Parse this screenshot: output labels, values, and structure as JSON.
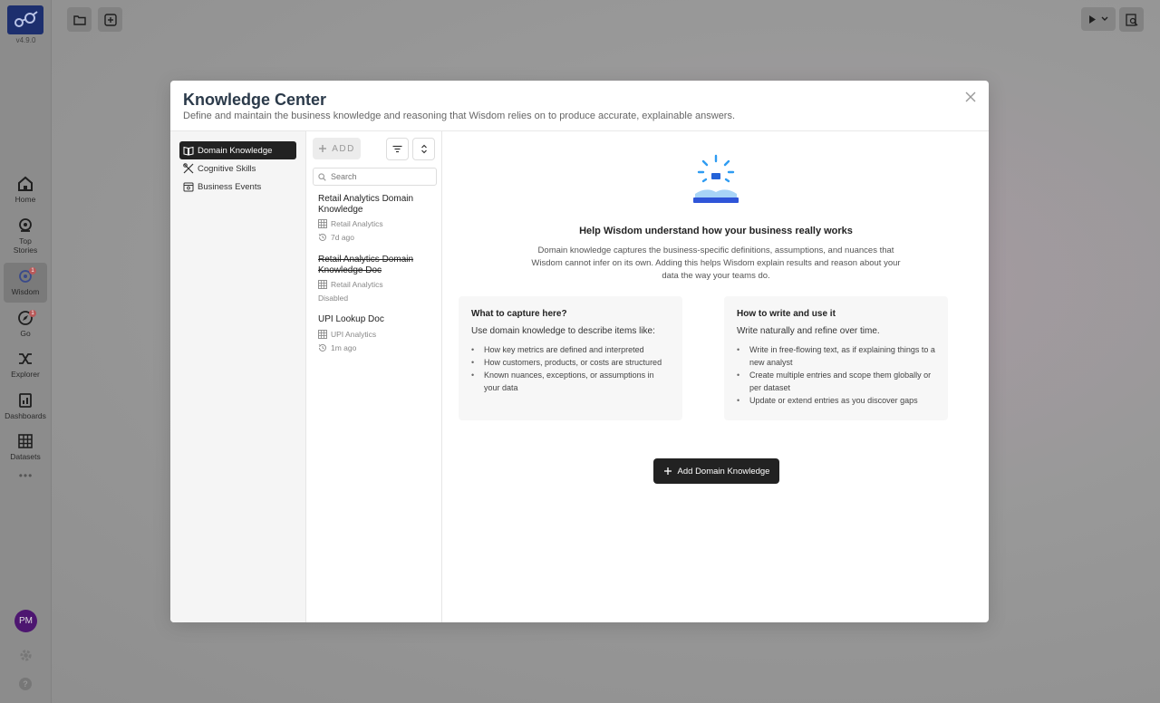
{
  "app": {
    "version": "v4.9.0",
    "nav": [
      {
        "label": "Home",
        "icon": "home-icon"
      },
      {
        "label": "Top Stories",
        "icon": "stories-icon"
      },
      {
        "label": "Wisdom",
        "icon": "wisdom-icon",
        "badge": "1"
      },
      {
        "label": "Go",
        "icon": "compass-icon",
        "badge": "1"
      },
      {
        "label": "Explorer",
        "icon": "shuffle-icon"
      },
      {
        "label": "Dashboards",
        "icon": "dashboard-icon"
      },
      {
        "label": "Datasets",
        "icon": "grid-icon"
      }
    ],
    "avatar": "PM",
    "help_label": "?"
  },
  "modal": {
    "title": "Knowledge Center",
    "subtitle": "Define and maintain the business knowledge and reasoning that Wisdom relies on to produce accurate, explainable answers.",
    "sections": [
      {
        "label": "Domain Knowledge",
        "icon": "book-icon",
        "active": true
      },
      {
        "label": "Cognitive Skills",
        "icon": "tools-icon",
        "active": false
      },
      {
        "label": "Business Events",
        "icon": "calendar-icon",
        "active": false
      }
    ],
    "list": {
      "add_label": "ADD",
      "search_placeholder": "Search",
      "entries": [
        {
          "title": "Retail Analytics Domain Knowledge",
          "dataset": "Retail Analytics",
          "status": "7d ago",
          "disabled": false
        },
        {
          "title": "Retail Analytics Domain Knowledge Doc",
          "dataset": "Retail Analytics",
          "status": "Disabled",
          "disabled": true
        },
        {
          "title": "UPI Lookup Doc",
          "dataset": "UPI Analytics",
          "status": "1m ago",
          "disabled": false
        }
      ]
    },
    "content": {
      "heading": "Help Wisdom understand how your business really works",
      "description": "Domain knowledge captures the business-specific definitions, assumptions, and nuances that Wisdom cannot infer on its own. Adding this helps Wisdom explain results and reason about your data the way your teams do.",
      "cards": [
        {
          "title": "What to capture here?",
          "lead": "Use domain knowledge to describe items like:",
          "items": [
            "How key metrics are defined and interpreted",
            "How customers, products, or costs are structured",
            "Known nuances, exceptions, or assumptions in your data"
          ]
        },
        {
          "title": "How to write and use it",
          "lead": "Write naturally and refine over time.",
          "items": [
            "Write in free-flowing text, as if explaining things to a new analyst",
            "Create multiple entries and scope them globally or per dataset",
            "Update or extend entries as you discover gaps"
          ]
        }
      ],
      "cta_label": "Add Domain Knowledge"
    }
  },
  "colors": {
    "primary": "#222222",
    "title": "#2b3a4a",
    "hero_blue": "#2f9cf2",
    "logo_bg": "#1d2f6e"
  }
}
